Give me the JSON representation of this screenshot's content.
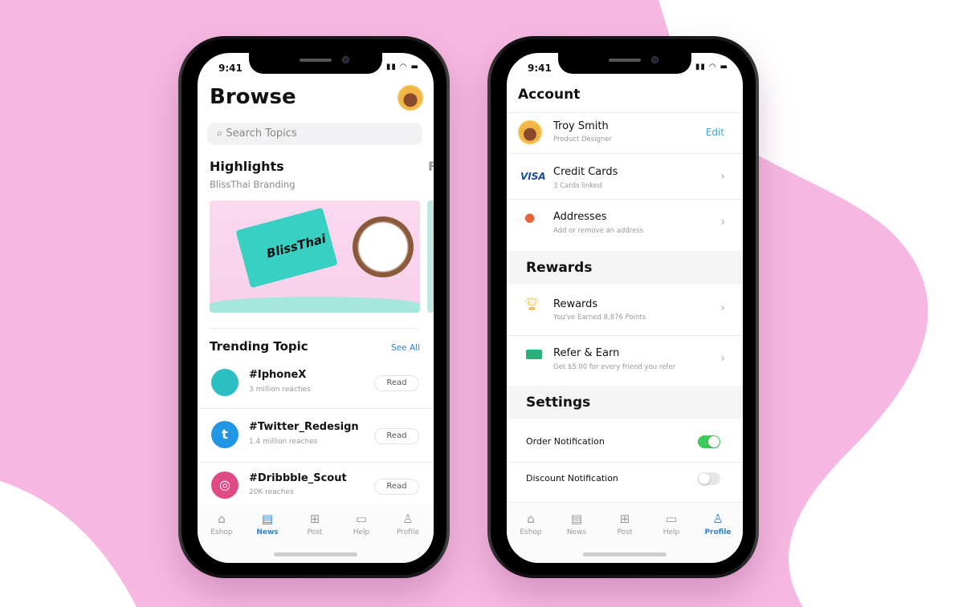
{
  "colors": {
    "background_pink": "#f6b8e2",
    "accent_blue": "#2a82d8",
    "toggle_on": "#3ecb5a",
    "edit_blue": "#3aa6d8"
  },
  "browse_screen": {
    "status": {
      "time": "9:41"
    },
    "title": "Browse",
    "search": {
      "placeholder": "Search Topics",
      "icon": "search-icon"
    },
    "highlights": {
      "title": "Highlights",
      "subtitle": "BlissThai Branding",
      "card_text": "BlissThai",
      "peek_letter": "F"
    },
    "trending": {
      "title": "Trending Topic",
      "see_all": "See All",
      "items": [
        {
          "name": "#IphoneX",
          "reach": "3 million reaches",
          "icon": "apple-icon",
          "color": "#2bbfc4",
          "action": "Read"
        },
        {
          "name": "#Twitter_Redesign",
          "reach": "1.4 million reaches",
          "icon": "twitter-icon",
          "color": "#2196e3",
          "action": "Read"
        },
        {
          "name": "#Dribbble_Scout",
          "reach": "20K reaches",
          "icon": "dribbble-icon",
          "color": "#e04a85",
          "action": "Read"
        }
      ]
    },
    "tabs": [
      {
        "label": "Eshop",
        "icon": "home-icon"
      },
      {
        "label": "News",
        "icon": "news-icon",
        "active": true
      },
      {
        "label": "Post",
        "icon": "post-icon"
      },
      {
        "label": "Help",
        "icon": "chat-icon"
      },
      {
        "label": "Profile",
        "icon": "person-icon"
      }
    ]
  },
  "account_screen": {
    "status": {
      "time": "9:41"
    },
    "title": "Account",
    "profile": {
      "name": "Troy Smith",
      "role": "Product Designer",
      "edit": "Edit"
    },
    "account_items": [
      {
        "title": "Credit Cards",
        "subtitle": "3 Cards linked",
        "icon": "visa-icon",
        "icon_text": "VISA"
      },
      {
        "title": "Addresses",
        "subtitle": "Add or remove an address",
        "icon": "location-pin-icon"
      }
    ],
    "rewards_section": "Rewards",
    "reward_items": [
      {
        "title": "Rewards",
        "subtitle": "You've Earned 8,876 Points",
        "icon": "trophy-icon"
      },
      {
        "title": "Refer & Earn",
        "subtitle": "Get $5.00 for every friend you refer",
        "icon": "cash-icon"
      }
    ],
    "settings_section": "Settings",
    "settings": [
      {
        "label": "Order Notification",
        "on": true
      },
      {
        "label": "Discount Notification",
        "on": false
      }
    ],
    "tabs": [
      {
        "label": "Eshop",
        "icon": "home-icon"
      },
      {
        "label": "News",
        "icon": "news-icon"
      },
      {
        "label": "Post",
        "icon": "post-icon"
      },
      {
        "label": "Help",
        "icon": "chat-icon"
      },
      {
        "label": "Profile",
        "icon": "person-icon",
        "active": true
      }
    ]
  }
}
